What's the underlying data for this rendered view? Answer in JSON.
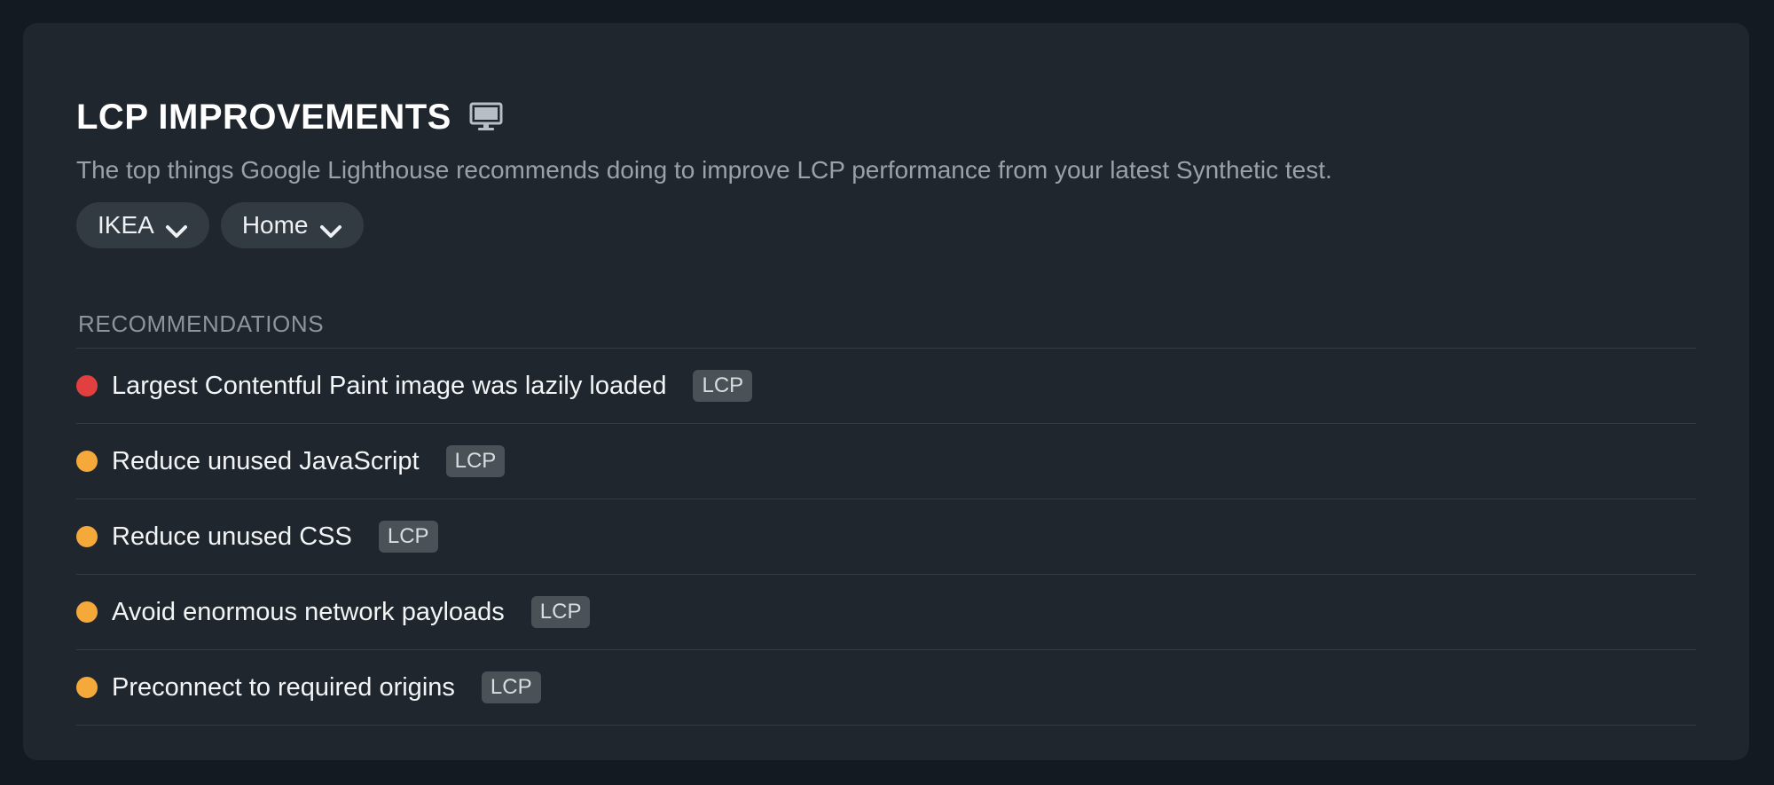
{
  "panel": {
    "title": "LCP IMPROVEMENTS",
    "title_icon": "monitor-icon",
    "subtitle": "The top things Google Lighthouse recommends doing to improve LCP performance from your latest Synthetic test."
  },
  "filters": [
    {
      "label": "IKEA",
      "icon": "chevron-down-icon"
    },
    {
      "label": "Home",
      "icon": "chevron-down-icon"
    }
  ],
  "recommendations": {
    "heading": "RECOMMENDATIONS",
    "items": [
      {
        "text": "Largest Contentful Paint image was lazily loaded",
        "badge": "LCP",
        "status_color": "#e24040"
      },
      {
        "text": "Reduce unused JavaScript",
        "badge": "LCP",
        "status_color": "#f5a93a"
      },
      {
        "text": "Reduce unused CSS",
        "badge": "LCP",
        "status_color": "#f5a93a"
      },
      {
        "text": "Avoid enormous network payloads",
        "badge": "LCP",
        "status_color": "#f5a93a"
      },
      {
        "text": "Preconnect to required origins",
        "badge": "LCP",
        "status_color": "#f5a93a"
      }
    ]
  },
  "colors": {
    "background": "#141a21",
    "card": "#1f262d",
    "pill": "#323a42",
    "badge": "#4a5157",
    "critical": "#e24040",
    "warning": "#f5a93a"
  }
}
